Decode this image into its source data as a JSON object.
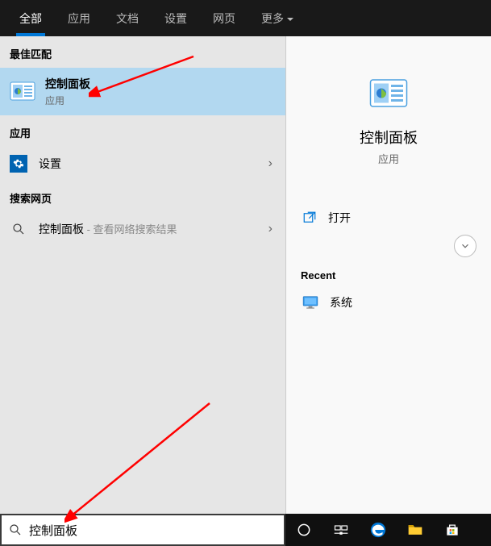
{
  "topbar": {
    "tabs": [
      {
        "label": "全部",
        "active": true
      },
      {
        "label": "应用",
        "active": false
      },
      {
        "label": "文档",
        "active": false
      },
      {
        "label": "设置",
        "active": false
      },
      {
        "label": "网页",
        "active": false
      },
      {
        "label": "更多",
        "active": false,
        "dropdown": true
      }
    ]
  },
  "left": {
    "best_match_header": "最佳匹配",
    "best_match": {
      "title": "控制面板",
      "subtitle": "应用"
    },
    "apps_header": "应用",
    "apps": [
      {
        "title": "设置"
      }
    ],
    "web_header": "搜索网页",
    "web": [
      {
        "title": "控制面板",
        "hint": " - 查看网络搜索结果"
      }
    ]
  },
  "right": {
    "title": "控制面板",
    "subtitle": "应用",
    "open_label": "打开",
    "recent_header": "Recent",
    "recent": [
      {
        "label": "系统"
      }
    ]
  },
  "search": {
    "value": "控制面板"
  }
}
